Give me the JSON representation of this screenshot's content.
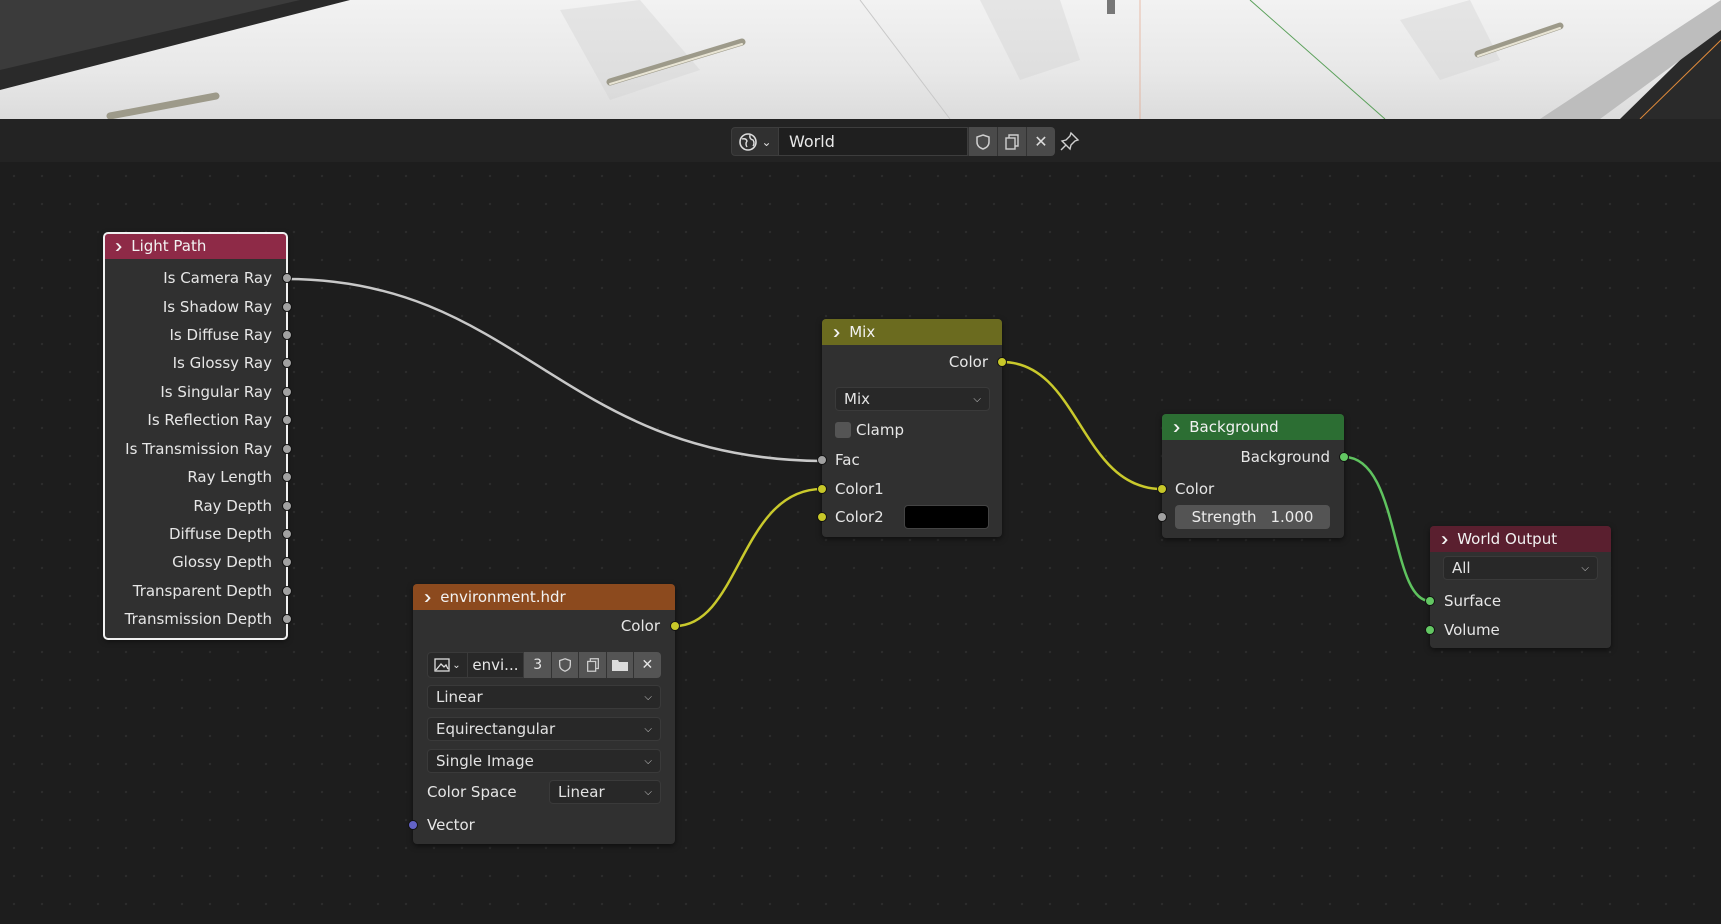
{
  "header": {
    "world_icon": "world-icon",
    "id_name": "World",
    "fake_user_icon": "shield-icon",
    "duplicate_icon": "duplicate-icon",
    "unlink_icon": "close-icon",
    "pin_icon": "pin-icon"
  },
  "nodes": {
    "light_path": {
      "title": "Light Path",
      "header_color": "#8e2a47",
      "outputs": [
        "Is Camera Ray",
        "Is Shadow Ray",
        "Is Diffuse Ray",
        "Is Glossy Ray",
        "Is Singular Ray",
        "Is Reflection Ray",
        "Is Transmission Ray",
        "Ray Length",
        "Ray Depth",
        "Diffuse Depth",
        "Glossy Depth",
        "Transparent Depth",
        "Transmission Depth"
      ]
    },
    "mix": {
      "title": "Mix",
      "header_color": "#6b6b1f",
      "output": "Color",
      "blend_mode": "Mix",
      "clamp_label": "Clamp",
      "fac": "Fac",
      "color1": "Color1",
      "color2": "Color2",
      "color2_value": "#000000"
    },
    "environment": {
      "title": "environment.hdr",
      "header_color": "#8c4a1e",
      "output": "Color",
      "image_name": "envi...",
      "users": "3",
      "interpolation": "Linear",
      "projection": "Equirectangular",
      "source": "Single Image",
      "color_space_label": "Color Space",
      "color_space": "Linear",
      "vector": "Vector"
    },
    "background": {
      "title": "Background",
      "header_color": "#2c6e33",
      "output": "Background",
      "color": "Color",
      "strength_label": "Strength",
      "strength_value": "1.000"
    },
    "world_output": {
      "title": "World Output",
      "header_color": "#5a1f2f",
      "target": "All",
      "surface": "Surface",
      "volume": "Volume"
    }
  },
  "colors": {
    "link_gray": "#c8c8c8",
    "link_yellow": "#c9c92c",
    "link_green": "#5fc35f"
  }
}
